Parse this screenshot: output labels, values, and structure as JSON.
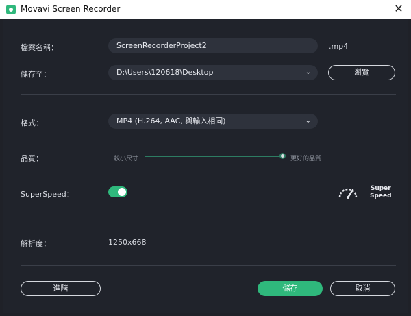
{
  "window": {
    "title": "Movavi Screen Recorder",
    "close_icon": "close-icon"
  },
  "file": {
    "label": "檔案名稱：",
    "value": "ScreenRecorderProject2",
    "suffix": ".mp4"
  },
  "save": {
    "label": "儲存至：",
    "path": "D:\\Users\\120618\\Desktop",
    "browse": "瀏覽"
  },
  "format": {
    "label": "格式：",
    "value": "MP4 (H.264, AAC, 與輸入相同)"
  },
  "quality": {
    "label": "品質：",
    "min_label": "較小尺寸",
    "max_label": "更好的品質",
    "level": 1.0
  },
  "superspeed": {
    "label": "SuperSpeed：",
    "enabled": true,
    "brand_line1": "Super",
    "brand_line2": "Speed"
  },
  "resolution": {
    "label": "解析度：",
    "value": "1250x668"
  },
  "buttons": {
    "advanced": "進階",
    "save": "儲存",
    "cancel": "取消"
  },
  "colors": {
    "accent": "#2fb87c",
    "background": "#20232b"
  }
}
